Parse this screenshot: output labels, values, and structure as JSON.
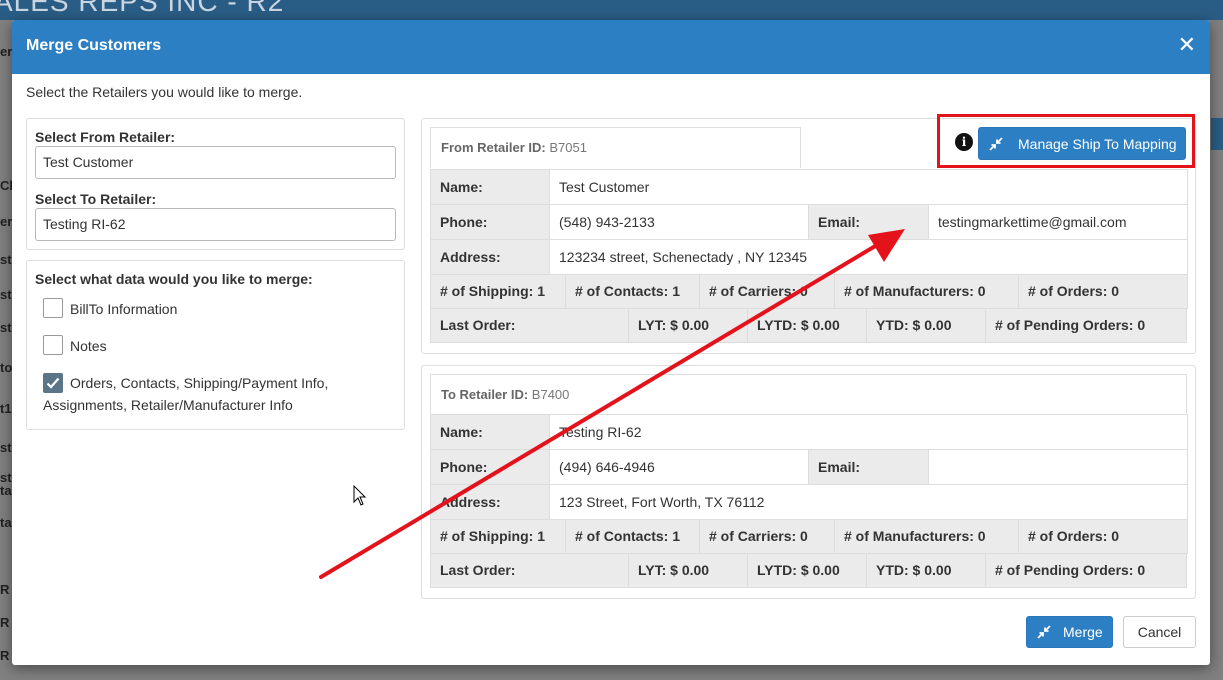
{
  "background": {
    "title": "ALES REPS INC - R2",
    "side_fragments": [
      "er",
      "Cl",
      "er",
      "st",
      "st",
      "st",
      "to",
      "t1",
      "st",
      "st",
      "ta",
      "ta",
      "R",
      "R",
      "R"
    ]
  },
  "modal": {
    "title": "Merge Customers",
    "intro": "Select the Retailers you would like to merge.",
    "from_label": "Select From Retailer:",
    "from_value": "Test Customer",
    "to_label": "Select To Retailer:",
    "to_value": "Testing RI-62",
    "merge_section_label": "Select what data would you like to merge:",
    "options": [
      {
        "label": "BillTo Information",
        "checked": false
      },
      {
        "label": "Notes",
        "checked": false
      },
      {
        "label": "Orders, Contacts, Shipping/Payment Info, Assignments, Retailer/Manufacturer Info",
        "checked": true
      }
    ],
    "manage_button": "Manage Ship To Mapping",
    "merge_button": "Merge",
    "cancel_button": "Cancel"
  },
  "from_card": {
    "id_label": "From Retailer ID:",
    "id_value": "B7051",
    "name_label": "Name:",
    "name": "Test Customer",
    "phone_label": "Phone:",
    "phone": "(548) 943-2133",
    "email_label": "Email:",
    "email": "testingmarkettime@gmail.com",
    "address_label": "Address:",
    "address": "123234 street, Schenectady , NY 12345",
    "shipping": "# of Shipping: 1",
    "contacts": "# of Contacts: 1",
    "carriers": "# of Carriers: 0",
    "manufacturers": "# of Manufacturers: 0",
    "orders": "# of Orders: 0",
    "last_order": "Last Order:",
    "lyt": "LYT: $ 0.00",
    "lytd": "LYTD: $ 0.00",
    "ytd": "YTD: $ 0.00",
    "pending": "# of Pending Orders: 0"
  },
  "to_card": {
    "id_label": "To Retailer ID:",
    "id_value": "B7400",
    "name_label": "Name:",
    "name": "Testing RI-62",
    "phone_label": "Phone:",
    "phone": "(494) 646-4946",
    "email_label": "Email:",
    "email": "",
    "address_label": "Address:",
    "address": "123 Street, Fort Worth, TX 76112",
    "shipping": "# of Shipping: 1",
    "contacts": "# of Contacts: 1",
    "carriers": "# of Carriers: 0",
    "manufacturers": "# of Manufacturers: 0",
    "orders": "# of Orders: 0",
    "last_order": "Last Order:",
    "lyt": "LYT: $ 0.00",
    "lytd": "LYTD: $ 0.00",
    "ytd": "YTD: $ 0.00",
    "pending": "# of Pending Orders: 0"
  },
  "icons": {
    "close": "close-icon",
    "info": "info-icon",
    "merge": "merge-arrows-icon",
    "check": "checkmark-icon"
  },
  "colors": {
    "header": "#2d7fc4",
    "highlight": "#e3121b",
    "annotation_arrow": "#e3121b",
    "checkbox_checked": "#5c7488"
  }
}
